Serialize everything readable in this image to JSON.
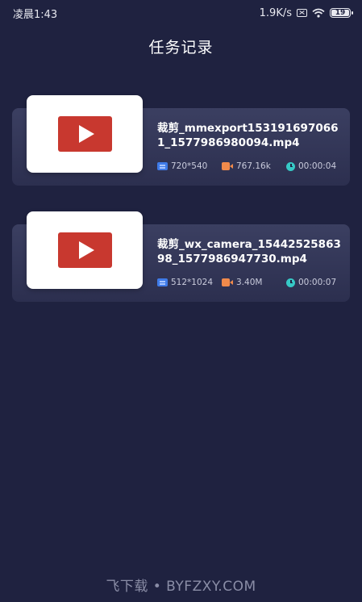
{
  "status_bar": {
    "time": "凌晨1:43",
    "net_speed": "1.9K/s",
    "battery": "19"
  },
  "page": {
    "title": "任务记录"
  },
  "tasks": [
    {
      "name": "裁剪_mmexport1531916970661_1577986980094.mp4",
      "resolution": "720*540",
      "size": "767.16k",
      "duration": "00:00:04"
    },
    {
      "name": "裁剪_wx_camera_1544252586398_1577986947730.mp4",
      "resolution": "512*1024",
      "size": "3.40M",
      "duration": "00:00:07"
    }
  ],
  "watermark": "飞下载 • BYFZXY.COM",
  "colors": {
    "background": "#1f2240",
    "card": "#363a5b",
    "play_red": "#c8382f",
    "resolution_icon": "#3f7be8",
    "size_icon": "#f08a4b",
    "duration_icon": "#36c9c6"
  },
  "icons": {
    "resolution": "screen-icon",
    "size": "video-camera-icon",
    "duration": "clock-icon",
    "thumbnail": "play-icon"
  }
}
